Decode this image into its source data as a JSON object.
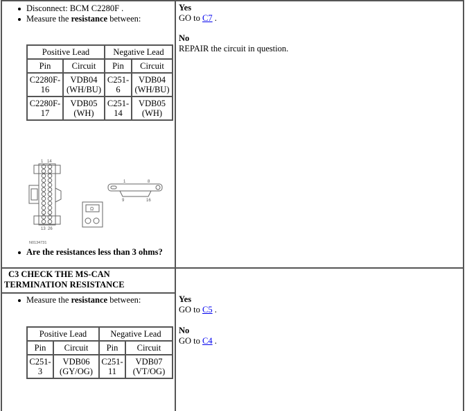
{
  "step_c2": {
    "bullets": [
      {
        "text": "Disconnect: BCM C2280F ."
      },
      {
        "pre": "Measure the ",
        "bold": "resistance",
        "post": " between:"
      }
    ],
    "table": {
      "group_headers": [
        "Positive Lead",
        "Negative Lead"
      ],
      "col_headers": [
        "Pin",
        "Circuit",
        "Pin",
        "Circuit"
      ],
      "rows": [
        [
          "C2280F-16",
          "VDB04 (WH/BU)",
          "C251-6",
          "VDB04 (WH/BU)"
        ],
        [
          "C2280F-17",
          "VDB05 (WH)",
          "C251-14",
          "VDB05 (WH)"
        ]
      ]
    },
    "figure": {
      "connector_a_labels": [
        "1",
        "14",
        "13",
        "26"
      ],
      "connector_b_labels": [
        "1",
        "8",
        "9",
        "16"
      ],
      "meter_symbol": "Ω",
      "figure_id": "N0134731"
    },
    "question": "Are the resistances less than 3 ohms?",
    "yes": {
      "label": "Yes",
      "action": "GO to ",
      "link": "C7",
      "suffix": " ."
    },
    "no": {
      "label": "No",
      "action": "REPAIR the circuit in question."
    }
  },
  "step_c3": {
    "title": "C3 CHECK THE MS-CAN TERMINATION RESISTANCE",
    "bullets": [
      {
        "pre": "Measure the ",
        "bold": "resistance",
        "post": " between:"
      }
    ],
    "table": {
      "group_headers": [
        "Positive Lead",
        "Negative Lead"
      ],
      "col_headers": [
        "Pin",
        "Circuit",
        "Pin",
        "Circuit"
      ],
      "rows": [
        [
          "C251-3",
          "VDB06 (GY/OG)",
          "C251-11",
          "VDB07 (VT/OG)"
        ]
      ]
    },
    "yes": {
      "label": "Yes",
      "action": "GO to ",
      "link": "C5",
      "suffix": " ."
    },
    "no": {
      "label": "No",
      "action": "GO to ",
      "link": "C4",
      "suffix": " ."
    }
  }
}
